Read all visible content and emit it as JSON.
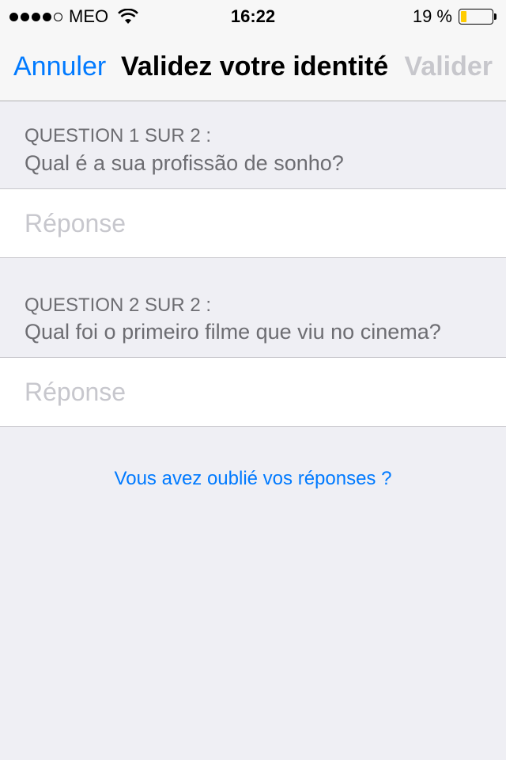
{
  "status_bar": {
    "carrier": "MEO",
    "time": "16:22",
    "battery_percent": "19 %",
    "battery_level": 0.19,
    "signal_bars": 4,
    "signal_max": 5
  },
  "nav": {
    "cancel_label": "Annuler",
    "title": "Validez votre identité",
    "validate_label": "Valider"
  },
  "questions": [
    {
      "header": "QUESTION 1 SUR 2 :",
      "text": "Qual é a sua profissão de sonho?",
      "placeholder": "Réponse",
      "value": ""
    },
    {
      "header": "QUESTION 2 SUR 2 :",
      "text": "Qual foi o primeiro filme que viu no cinema?",
      "placeholder": "Réponse",
      "value": ""
    }
  ],
  "forgot_link": "Vous avez oublié vos réponses ?",
  "colors": {
    "accent": "#007aff",
    "disabled": "#c7c7cc",
    "background": "#efeff4",
    "battery": "#ffcc00"
  }
}
